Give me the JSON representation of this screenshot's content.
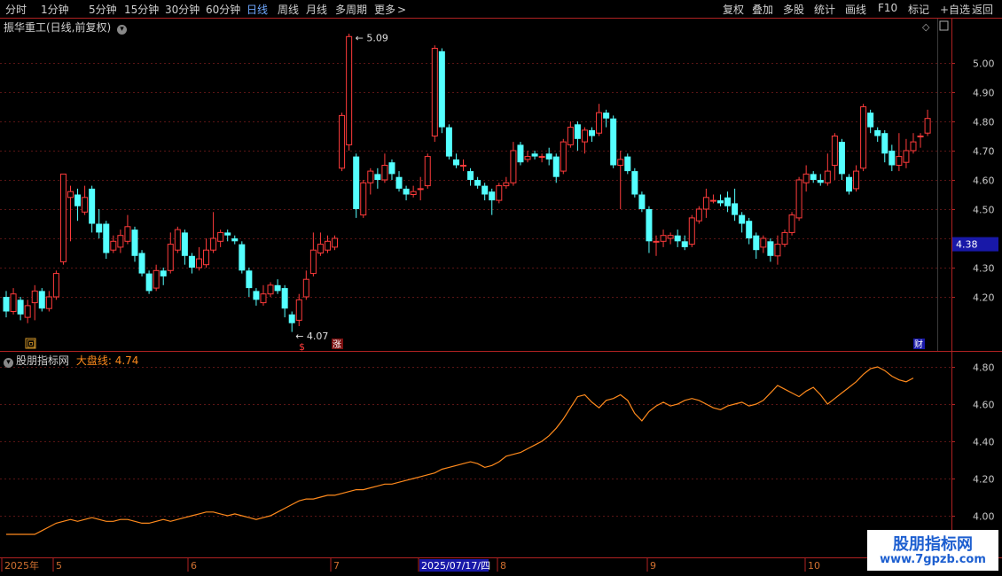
{
  "toolbar": {
    "periods": [
      "分时",
      "1分钟",
      "5分钟",
      "15分钟",
      "30分钟",
      "60分钟",
      "日线",
      "周线",
      "月线",
      "多周期",
      "更多"
    ],
    "active": "日线",
    "more_arrow": ">",
    "actions": [
      "复权",
      "叠加",
      "多股",
      "统计",
      "画线",
      "F10",
      "标记",
      "+自选",
      "返回"
    ]
  },
  "main_panel": {
    "title": "振华重工(日线,前复权)",
    "price_ticks": [
      "5.00",
      "4.90",
      "4.80",
      "4.70",
      "4.60",
      "4.50",
      "4.30",
      "4.20"
    ],
    "price_tag": "4.38",
    "high_label": "5.09",
    "low_label": "4.07",
    "markers": {
      "left": "回",
      "s": "$",
      "zhang": "涨",
      "cai": "财"
    },
    "colors": {
      "up": "#ff3b3b",
      "down": "#54ffff",
      "price_tag_bg": "#1818a8",
      "axis": "#b02222"
    }
  },
  "indicator_panel": {
    "name": "股朋指标网",
    "line_label": "大盘线:",
    "line_value": "4.74",
    "ticks": [
      "4.80",
      "4.60",
      "4.40",
      "4.20",
      "4.00"
    ],
    "line_color": "#ff8a1c"
  },
  "date_axis": {
    "labels": [
      "2025年",
      "5",
      "6",
      "7",
      "2025/07/17/四",
      "8",
      "9",
      "10"
    ]
  },
  "watermark": {
    "line1": "股朋指标网",
    "line2": "www.7gpzb.com"
  },
  "chart_data": {
    "type": "candlestick",
    "price_range": [
      4.07,
      5.09
    ],
    "candles": [
      [
        4.2,
        4.15,
        4.22,
        4.13
      ],
      [
        4.15,
        4.21,
        4.23,
        4.14
      ],
      [
        4.19,
        4.14,
        4.2,
        4.12
      ],
      [
        4.13,
        4.17,
        4.19,
        4.11
      ],
      [
        4.18,
        4.22,
        4.24,
        4.12
      ],
      [
        4.22,
        4.16,
        4.23,
        4.15
      ],
      [
        4.16,
        4.2,
        4.22,
        4.15
      ],
      [
        4.2,
        4.28,
        4.29,
        4.19
      ],
      [
        4.32,
        4.62,
        4.62,
        4.31
      ],
      [
        4.54,
        4.56,
        4.58,
        4.39
      ],
      [
        4.55,
        4.51,
        4.57,
        4.46
      ],
      [
        4.49,
        4.54,
        4.58,
        4.48
      ],
      [
        4.57,
        4.45,
        4.58,
        4.42
      ],
      [
        4.45,
        4.42,
        4.5,
        4.4
      ],
      [
        4.45,
        4.35,
        4.46,
        4.33
      ],
      [
        4.36,
        4.39,
        4.41,
        4.35
      ],
      [
        4.37,
        4.41,
        4.43,
        4.35
      ],
      [
        4.39,
        4.44,
        4.48,
        4.38
      ],
      [
        4.43,
        4.34,
        4.44,
        4.32
      ],
      [
        4.35,
        4.28,
        4.36,
        4.27
      ],
      [
        4.28,
        4.22,
        4.29,
        4.21
      ],
      [
        4.23,
        4.29,
        4.31,
        4.22
      ],
      [
        4.29,
        4.27,
        4.3,
        4.24
      ],
      [
        4.29,
        4.38,
        4.42,
        4.28
      ],
      [
        4.36,
        4.43,
        4.44,
        4.35
      ],
      [
        4.42,
        4.34,
        4.43,
        4.31
      ],
      [
        4.34,
        4.3,
        4.35,
        4.28
      ],
      [
        4.3,
        4.33,
        4.37,
        4.29
      ],
      [
        4.31,
        4.36,
        4.4,
        4.3
      ],
      [
        4.36,
        4.4,
        4.49,
        4.35
      ],
      [
        4.39,
        4.42,
        4.43,
        4.37
      ],
      [
        4.42,
        4.41,
        4.43,
        4.39
      ],
      [
        4.4,
        4.39,
        4.41,
        4.38
      ],
      [
        4.38,
        4.29,
        4.39,
        4.28
      ],
      [
        4.29,
        4.23,
        4.3,
        4.2
      ],
      [
        4.22,
        4.19,
        4.23,
        4.17
      ],
      [
        4.18,
        4.21,
        4.24,
        4.17
      ],
      [
        4.21,
        4.24,
        4.25,
        4.2
      ],
      [
        4.24,
        4.22,
        4.26,
        4.21
      ],
      [
        4.23,
        4.16,
        4.24,
        4.13
      ],
      [
        4.14,
        4.11,
        4.15,
        4.08
      ],
      [
        4.12,
        4.19,
        4.21,
        4.1
      ],
      [
        4.2,
        4.26,
        4.29,
        4.19
      ],
      [
        4.28,
        4.36,
        4.42,
        4.27
      ],
      [
        4.35,
        4.38,
        4.42,
        4.34
      ],
      [
        4.36,
        4.39,
        4.41,
        4.35
      ],
      [
        4.37,
        4.4,
        4.41,
        4.36
      ],
      [
        4.64,
        4.82,
        4.83,
        4.63
      ],
      [
        4.72,
        5.09,
        5.1,
        4.7
      ],
      [
        4.68,
        4.5,
        4.69,
        4.47
      ],
      [
        4.48,
        4.59,
        4.6,
        4.47
      ],
      [
        4.59,
        4.63,
        4.64,
        4.55
      ],
      [
        4.62,
        4.6,
        4.64,
        4.57
      ],
      [
        4.6,
        4.65,
        4.69,
        4.59
      ],
      [
        4.66,
        4.62,
        4.67,
        4.6
      ],
      [
        4.61,
        4.57,
        4.63,
        4.56
      ],
      [
        4.57,
        4.55,
        4.58,
        4.53
      ],
      [
        4.55,
        4.56,
        4.58,
        4.54
      ],
      [
        4.57,
        4.57,
        4.61,
        4.53
      ],
      [
        4.58,
        4.68,
        4.69,
        4.57
      ],
      [
        4.75,
        5.05,
        5.06,
        4.73
      ],
      [
        5.04,
        4.78,
        5.05,
        4.76
      ],
      [
        4.78,
        4.68,
        4.79,
        4.67
      ],
      [
        4.67,
        4.65,
        4.69,
        4.64
      ],
      [
        4.65,
        4.65,
        4.67,
        4.63
      ],
      [
        4.63,
        4.6,
        4.64,
        4.58
      ],
      [
        4.6,
        4.58,
        4.61,
        4.57
      ],
      [
        4.58,
        4.55,
        4.59,
        4.53
      ],
      [
        4.56,
        4.53,
        4.57,
        4.48
      ],
      [
        4.53,
        4.58,
        4.59,
        4.52
      ],
      [
        4.58,
        4.59,
        4.61,
        4.57
      ],
      [
        4.59,
        4.7,
        4.73,
        4.58
      ],
      [
        4.72,
        4.66,
        4.73,
        4.65
      ],
      [
        4.67,
        4.68,
        4.7,
        4.66
      ],
      [
        4.69,
        4.68,
        4.7,
        4.67
      ],
      [
        4.68,
        4.68,
        4.69,
        4.66
      ],
      [
        4.69,
        4.67,
        4.71,
        4.65
      ],
      [
        4.68,
        4.61,
        4.69,
        4.59
      ],
      [
        4.63,
        4.73,
        4.74,
        4.62
      ],
      [
        4.72,
        4.78,
        4.8,
        4.71
      ],
      [
        4.79,
        4.74,
        4.8,
        4.7
      ],
      [
        4.73,
        4.77,
        4.78,
        4.69
      ],
      [
        4.77,
        4.75,
        4.78,
        4.73
      ],
      [
        4.76,
        4.83,
        4.86,
        4.75
      ],
      [
        4.83,
        4.81,
        4.84,
        4.78
      ],
      [
        4.81,
        4.65,
        4.82,
        4.64
      ],
      [
        4.65,
        4.67,
        4.7,
        4.5
      ],
      [
        4.68,
        4.63,
        4.69,
        4.62
      ],
      [
        4.63,
        4.55,
        4.64,
        4.54
      ],
      [
        4.55,
        4.5,
        4.56,
        4.49
      ],
      [
        4.5,
        4.39,
        4.51,
        4.35
      ],
      [
        4.39,
        4.39,
        4.41,
        4.34
      ],
      [
        4.39,
        4.41,
        4.43,
        4.37
      ],
      [
        4.4,
        4.41,
        4.42,
        4.38
      ],
      [
        4.41,
        4.39,
        4.43,
        4.37
      ],
      [
        4.39,
        4.37,
        4.41,
        4.36
      ],
      [
        4.38,
        4.47,
        4.48,
        4.37
      ],
      [
        4.46,
        4.5,
        4.51,
        4.45
      ],
      [
        4.5,
        4.54,
        4.57,
        4.47
      ],
      [
        4.53,
        4.53,
        4.55,
        4.52
      ],
      [
        4.53,
        4.52,
        4.55,
        4.51
      ],
      [
        4.54,
        4.51,
        4.56,
        4.49
      ],
      [
        4.52,
        4.48,
        4.57,
        4.46
      ],
      [
        4.48,
        4.45,
        4.49,
        4.42
      ],
      [
        4.46,
        4.4,
        4.47,
        4.38
      ],
      [
        4.41,
        4.36,
        4.42,
        4.33
      ],
      [
        4.37,
        4.4,
        4.41,
        4.35
      ],
      [
        4.39,
        4.34,
        4.4,
        4.32
      ],
      [
        4.34,
        4.38,
        4.41,
        4.31
      ],
      [
        4.38,
        4.42,
        4.43,
        4.37
      ],
      [
        4.42,
        4.48,
        4.49,
        4.41
      ],
      [
        4.47,
        4.6,
        4.61,
        4.46
      ],
      [
        4.59,
        4.62,
        4.65,
        4.56
      ],
      [
        4.62,
        4.6,
        4.63,
        4.59
      ],
      [
        4.6,
        4.59,
        4.62,
        4.58
      ],
      [
        4.59,
        4.63,
        4.69,
        4.58
      ],
      [
        4.65,
        4.75,
        4.76,
        4.6
      ],
      [
        4.73,
        4.62,
        4.74,
        4.6
      ],
      [
        4.61,
        4.56,
        4.62,
        4.55
      ],
      [
        4.57,
        4.63,
        4.65,
        4.56
      ],
      [
        4.64,
        4.85,
        4.86,
        4.63
      ],
      [
        4.83,
        4.78,
        4.84,
        4.76
      ],
      [
        4.77,
        4.75,
        4.78,
        4.73
      ],
      [
        4.76,
        4.69,
        4.77,
        4.66
      ],
      [
        4.7,
        4.65,
        4.72,
        4.63
      ],
      [
        4.65,
        4.68,
        4.76,
        4.63
      ],
      [
        4.66,
        4.7,
        4.74,
        4.64
      ],
      [
        4.7,
        4.73,
        4.76,
        4.69
      ],
      [
        4.75,
        4.75,
        4.76,
        4.71
      ],
      [
        4.76,
        4.81,
        4.84,
        4.75
      ]
    ],
    "indicator": {
      "name": "大盘线",
      "range": [
        3.9,
        4.85
      ],
      "values": [
        3.9,
        3.9,
        3.9,
        3.9,
        3.9,
        3.92,
        3.94,
        3.96,
        3.97,
        3.98,
        3.97,
        3.98,
        3.99,
        3.98,
        3.97,
        3.97,
        3.98,
        3.98,
        3.97,
        3.96,
        3.96,
        3.97,
        3.98,
        3.97,
        3.98,
        3.99,
        4.0,
        4.01,
        4.02,
        4.02,
        4.01,
        4.0,
        4.01,
        4.0,
        3.99,
        3.98,
        3.99,
        4.0,
        4.02,
        4.04,
        4.06,
        4.08,
        4.09,
        4.09,
        4.1,
        4.11,
        4.11,
        4.12,
        4.13,
        4.14,
        4.14,
        4.15,
        4.16,
        4.17,
        4.17,
        4.18,
        4.19,
        4.2,
        4.21,
        4.22,
        4.23,
        4.25,
        4.26,
        4.27,
        4.28,
        4.29,
        4.28,
        4.26,
        4.27,
        4.29,
        4.32,
        4.33,
        4.34,
        4.36,
        4.38,
        4.4,
        4.43,
        4.47,
        4.52,
        4.58,
        4.64,
        4.65,
        4.61,
        4.58,
        4.62,
        4.63,
        4.65,
        4.62,
        4.55,
        4.51,
        4.56,
        4.59,
        4.61,
        4.59,
        4.6,
        4.62,
        4.63,
        4.62,
        4.6,
        4.58,
        4.57,
        4.59,
        4.6,
        4.61,
        4.59,
        4.6,
        4.62,
        4.66,
        4.7,
        4.68,
        4.66,
        4.64,
        4.67,
        4.69,
        4.65,
        4.6,
        4.63,
        4.66,
        4.69,
        4.72,
        4.76,
        4.79,
        4.8,
        4.78,
        4.75,
        4.73,
        4.72,
        4.74
      ]
    }
  }
}
